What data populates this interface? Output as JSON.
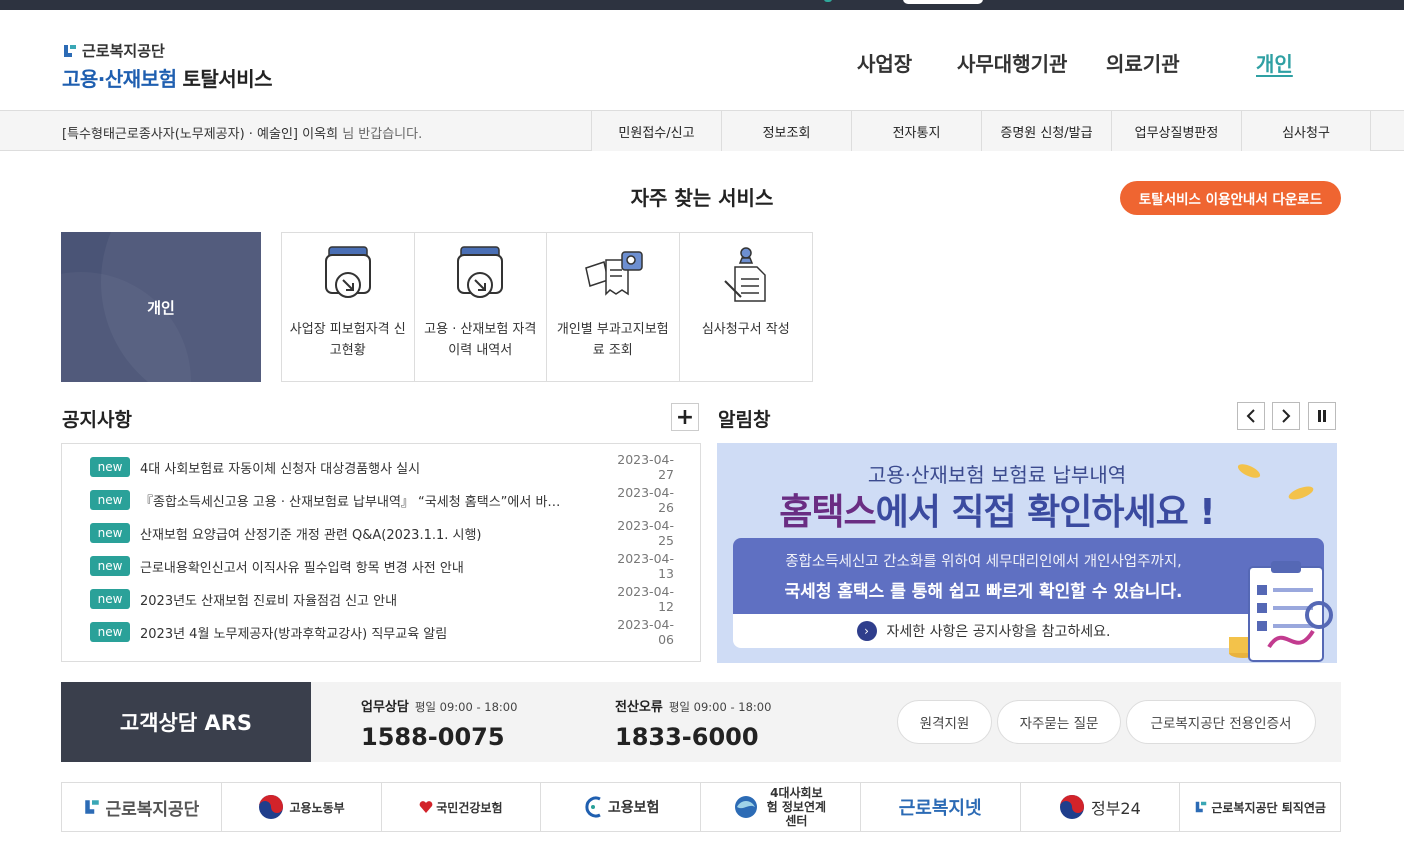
{
  "header": {
    "org_name": "근로복지공단",
    "service_blue": "고용·산재보험",
    "service_dark": "토탈서비스",
    "nav": [
      {
        "label": "사업장"
      },
      {
        "label": "사무대행기관"
      },
      {
        "label": "의료기관"
      },
      {
        "label": "개인",
        "active": true
      }
    ]
  },
  "subbar": {
    "greeting_prefix": "[특수형태근로종사자(노무제공자) · 예술인]",
    "user_name": "이옥희",
    "greeting_suffix": "님 반갑습니다.",
    "menu": [
      "민원접수/신고",
      "정보조회",
      "전자통지",
      "증명원 신청/발급",
      "업무상질병판정",
      "심사청구"
    ]
  },
  "favorites": {
    "title": "자주 찾는 서비스",
    "download_button": "토탈서비스 이용안내서 다운로드",
    "card_label": "개인",
    "items": [
      {
        "label": "사업장 피보험자격 신고현황",
        "icon": "document-download-icon"
      },
      {
        "label": "고용 · 산재보험 자격 이력 내역서",
        "icon": "document-download-icon"
      },
      {
        "label": "개인별 부과고지보험료 조회",
        "icon": "search-document-icon"
      },
      {
        "label": "심사청구서 작성",
        "icon": "pin-document-icon"
      }
    ]
  },
  "notices": {
    "title": "공지사항",
    "more_icon": "plus-icon",
    "badge": "new",
    "items": [
      {
        "title": "4대 사회보험료 자동이체 신청자 대상경품행사 실시",
        "date": "2023-04-27"
      },
      {
        "title": "『종합소득세신고용 고용 · 산재보험료 납부내역』 “국세청 홈택스”에서 바로 확인하세요",
        "date": "2023-04-26"
      },
      {
        "title": "산재보험 요양급여 산정기준 개정 관련 Q&A(2023.1.1. 시행)",
        "date": "2023-04-25"
      },
      {
        "title": "근로내용확인신고서 이직사유 필수입력 항목 변경 사전 안내",
        "date": "2023-04-13"
      },
      {
        "title": "2023년도 산재보험 진료비 자율점검 신고 안내",
        "date": "2023-04-12"
      },
      {
        "title": "2023년 4월 노무제공자(방과후학교강사) 직무교육 알림",
        "date": "2023-04-06"
      }
    ]
  },
  "alerts": {
    "title": "알림창",
    "controls": [
      "chevron-left-icon",
      "chevron-right-icon",
      "pause-icon"
    ],
    "banner": {
      "line1": "고용·산재보험 보험료 납부내역",
      "line2_accent": "홈택스",
      "line2_rest": "에서 직접 확인하세요 !",
      "panel_line1": "종합소득세신고 간소화를 위하여 세무대리인에서 개인사업주까지,",
      "panel_line2": "국세청 홈택스 를 통해 쉽고 빠르게 확인할 수 있습니다.",
      "panel_note": "자세한 사항은 공지사항을 참고하세요."
    }
  },
  "ars": {
    "title": "고객상담 ARS",
    "lines": [
      {
        "label": "업무상담",
        "hours": "평일 09:00 - 18:00",
        "number": "1588-0075"
      },
      {
        "label": "전산오류",
        "hours": "평일 09:00 - 18:00",
        "number": "1833-6000"
      }
    ],
    "links": [
      "원격지원",
      "자주묻는 질문",
      "근로복지공단 전용인증서"
    ]
  },
  "partners": [
    {
      "name": "근로복지공단"
    },
    {
      "name": "고용노동부"
    },
    {
      "name": "국민건강보험"
    },
    {
      "name": "고용보험"
    },
    {
      "name": "4대사회보험 정보연계센터"
    },
    {
      "name": "근로복지넷"
    },
    {
      "name": "정부24"
    },
    {
      "name": "근로복지공단 퇴직연금"
    }
  ],
  "colors": {
    "accent_teal": "#2aa199",
    "orange": "#ef6531",
    "navy_card": "#4a5476",
    "ars_dark": "#3a3f4c"
  }
}
